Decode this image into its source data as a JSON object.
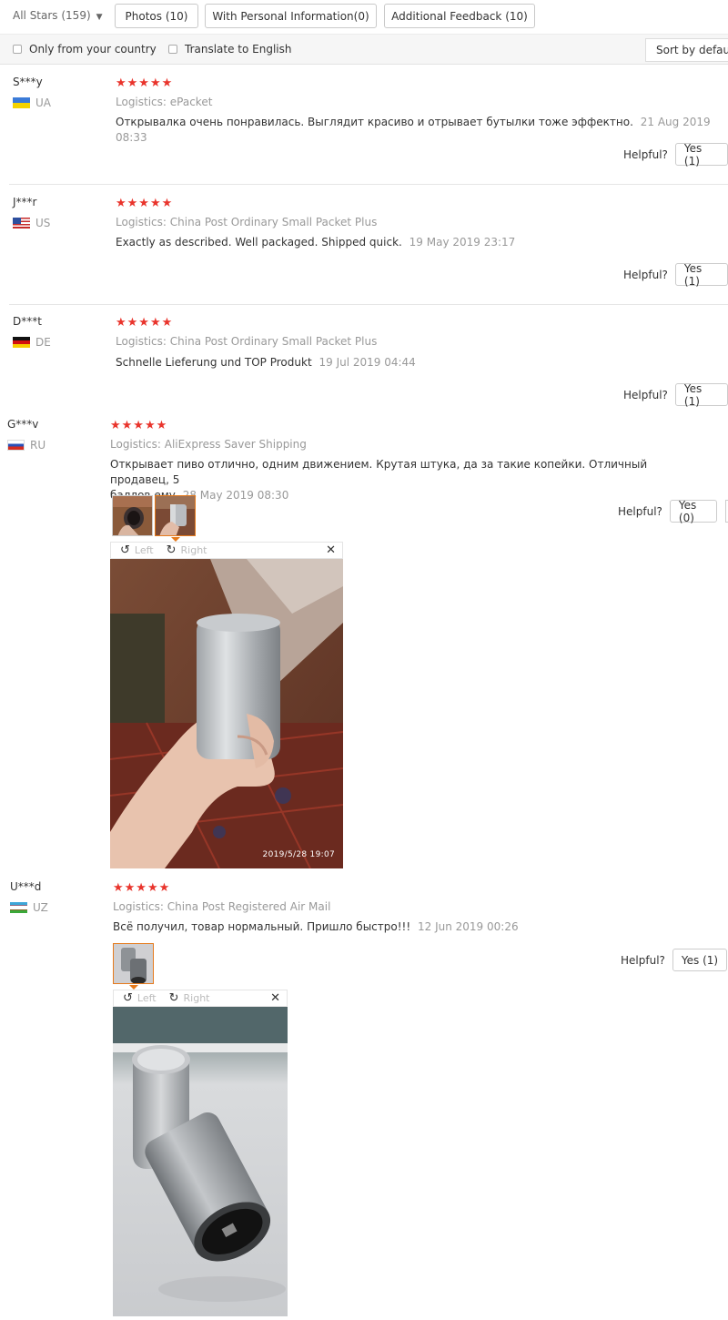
{
  "filters": {
    "all_stars": "All Stars (159)",
    "photos": "Photos (10)",
    "personal": "With Personal Information(0)",
    "additional": "Additional Feedback (10)"
  },
  "options": {
    "only_country": "Only from your country",
    "translate": "Translate to English",
    "sort": "Sort by default"
  },
  "helpful_label": "Helpful?",
  "viewer": {
    "left": "Left",
    "right": "Right"
  },
  "reviews": [
    {
      "user": "S***y",
      "country": "UA",
      "stars": "★★★★★",
      "logistics": "Logistics: ePacket",
      "text": "Открывалка очень понравилась. Выглядит красиво и отрывает бутылки тоже эффектно.",
      "date": "21 Aug 2019 08:33",
      "yes": "Yes (1)"
    },
    {
      "user": "J***r",
      "country": "US",
      "stars": "★★★★★",
      "logistics": "Logistics: China Post Ordinary Small Packet Plus",
      "text": "Exactly as described. Well packaged. Shipped quick.",
      "date": "19 May 2019 23:17",
      "yes": "Yes (1)"
    },
    {
      "user": "D***t",
      "country": "DE",
      "stars": "★★★★★",
      "logistics": "Logistics: China Post Ordinary Small Packet Plus",
      "text": "Schnelle Lieferung und TOP Produkt",
      "date": "19 Jul 2019 04:44",
      "yes": "Yes (1)"
    },
    {
      "user": "G***v",
      "country": "RU",
      "stars": "★★★★★",
      "logistics": "Logistics: AliExpress Saver Shipping",
      "text_line1": "Открывает пиво отлично, одним движением. Крутая штука, да за такие копейки. Отличный продавец, 5",
      "text_line2": "баллов ему",
      "date": "28 May 2019 08:30",
      "yes": "Yes (0)",
      "photo_stamp": "2019/5/28 19:07"
    },
    {
      "user": "U***d",
      "country": "UZ",
      "stars": "★★★★★",
      "logistics": "Logistics: China Post Registered Air Mail",
      "text": "Всё получил, товар нормальный. Пришло быстро!!!",
      "date": "12 Jun 2019 00:26",
      "yes": "Yes (1)"
    }
  ]
}
